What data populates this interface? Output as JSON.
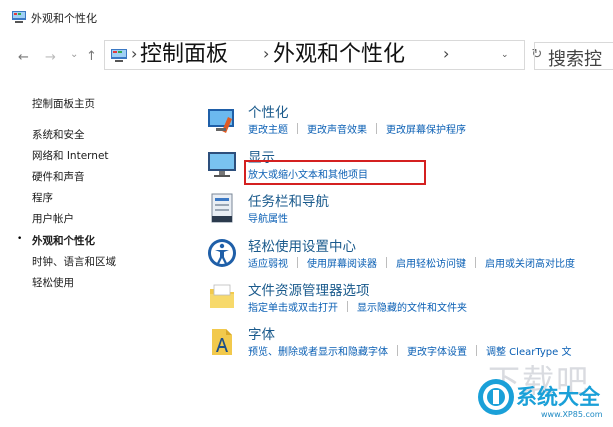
{
  "window": {
    "title": "外观和个性化"
  },
  "nav": {
    "back": "←",
    "forward": "→",
    "recent": "⌄",
    "up": "↑"
  },
  "address": {
    "crumbs": [
      "控制面板",
      "外观和个性化"
    ],
    "separator": "›",
    "dropdown": "⌄",
    "refresh": "↻"
  },
  "search": {
    "text": "搜索控"
  },
  "sidebar": {
    "items": [
      {
        "label": "控制面板主页",
        "active": false
      },
      {
        "label": "系统和安全",
        "active": false
      },
      {
        "label": "网络和 Internet",
        "active": false
      },
      {
        "label": "硬件和声音",
        "active": false
      },
      {
        "label": "程序",
        "active": false
      },
      {
        "label": "用户帐户",
        "active": false
      },
      {
        "label": "外观和个性化",
        "active": true
      },
      {
        "label": "时钟、语言和区域",
        "active": false
      },
      {
        "label": "轻松使用",
        "active": false
      }
    ],
    "bullet": "•"
  },
  "categories": [
    {
      "title": "个性化",
      "icon": "personalization-icon",
      "links": [
        "更改主题",
        "更改声音效果",
        "更改屏幕保护程序"
      ]
    },
    {
      "title": "显示",
      "icon": "display-icon",
      "links": [
        "放大或缩小文本和其他项目"
      ]
    },
    {
      "title": "任务栏和导航",
      "icon": "taskbar-icon",
      "links": [
        "导航属性"
      ]
    },
    {
      "title": "轻松使用设置中心",
      "icon": "ease-of-access-icon",
      "links": [
        "适应弱视",
        "使用屏幕阅读器",
        "启用轻松访问键",
        "启用或关闭高对比度"
      ]
    },
    {
      "title": "文件资源管理器选项",
      "icon": "folder-options-icon",
      "links": [
        "指定单击或双击打开",
        "显示隐藏的文件和文件夹"
      ]
    },
    {
      "title": "字体",
      "icon": "fonts-icon",
      "links": [
        "预览、删除或者显示和隐藏字体",
        "更改字体设置",
        "调整 ClearType 文"
      ]
    }
  ],
  "watermark": {
    "large": "下载吧",
    "brand": "系统大全",
    "url": "www.XP85.com"
  },
  "colors": {
    "link": "#0a5fb4",
    "title": "#1a5a8c",
    "highlight": "#d42020"
  }
}
